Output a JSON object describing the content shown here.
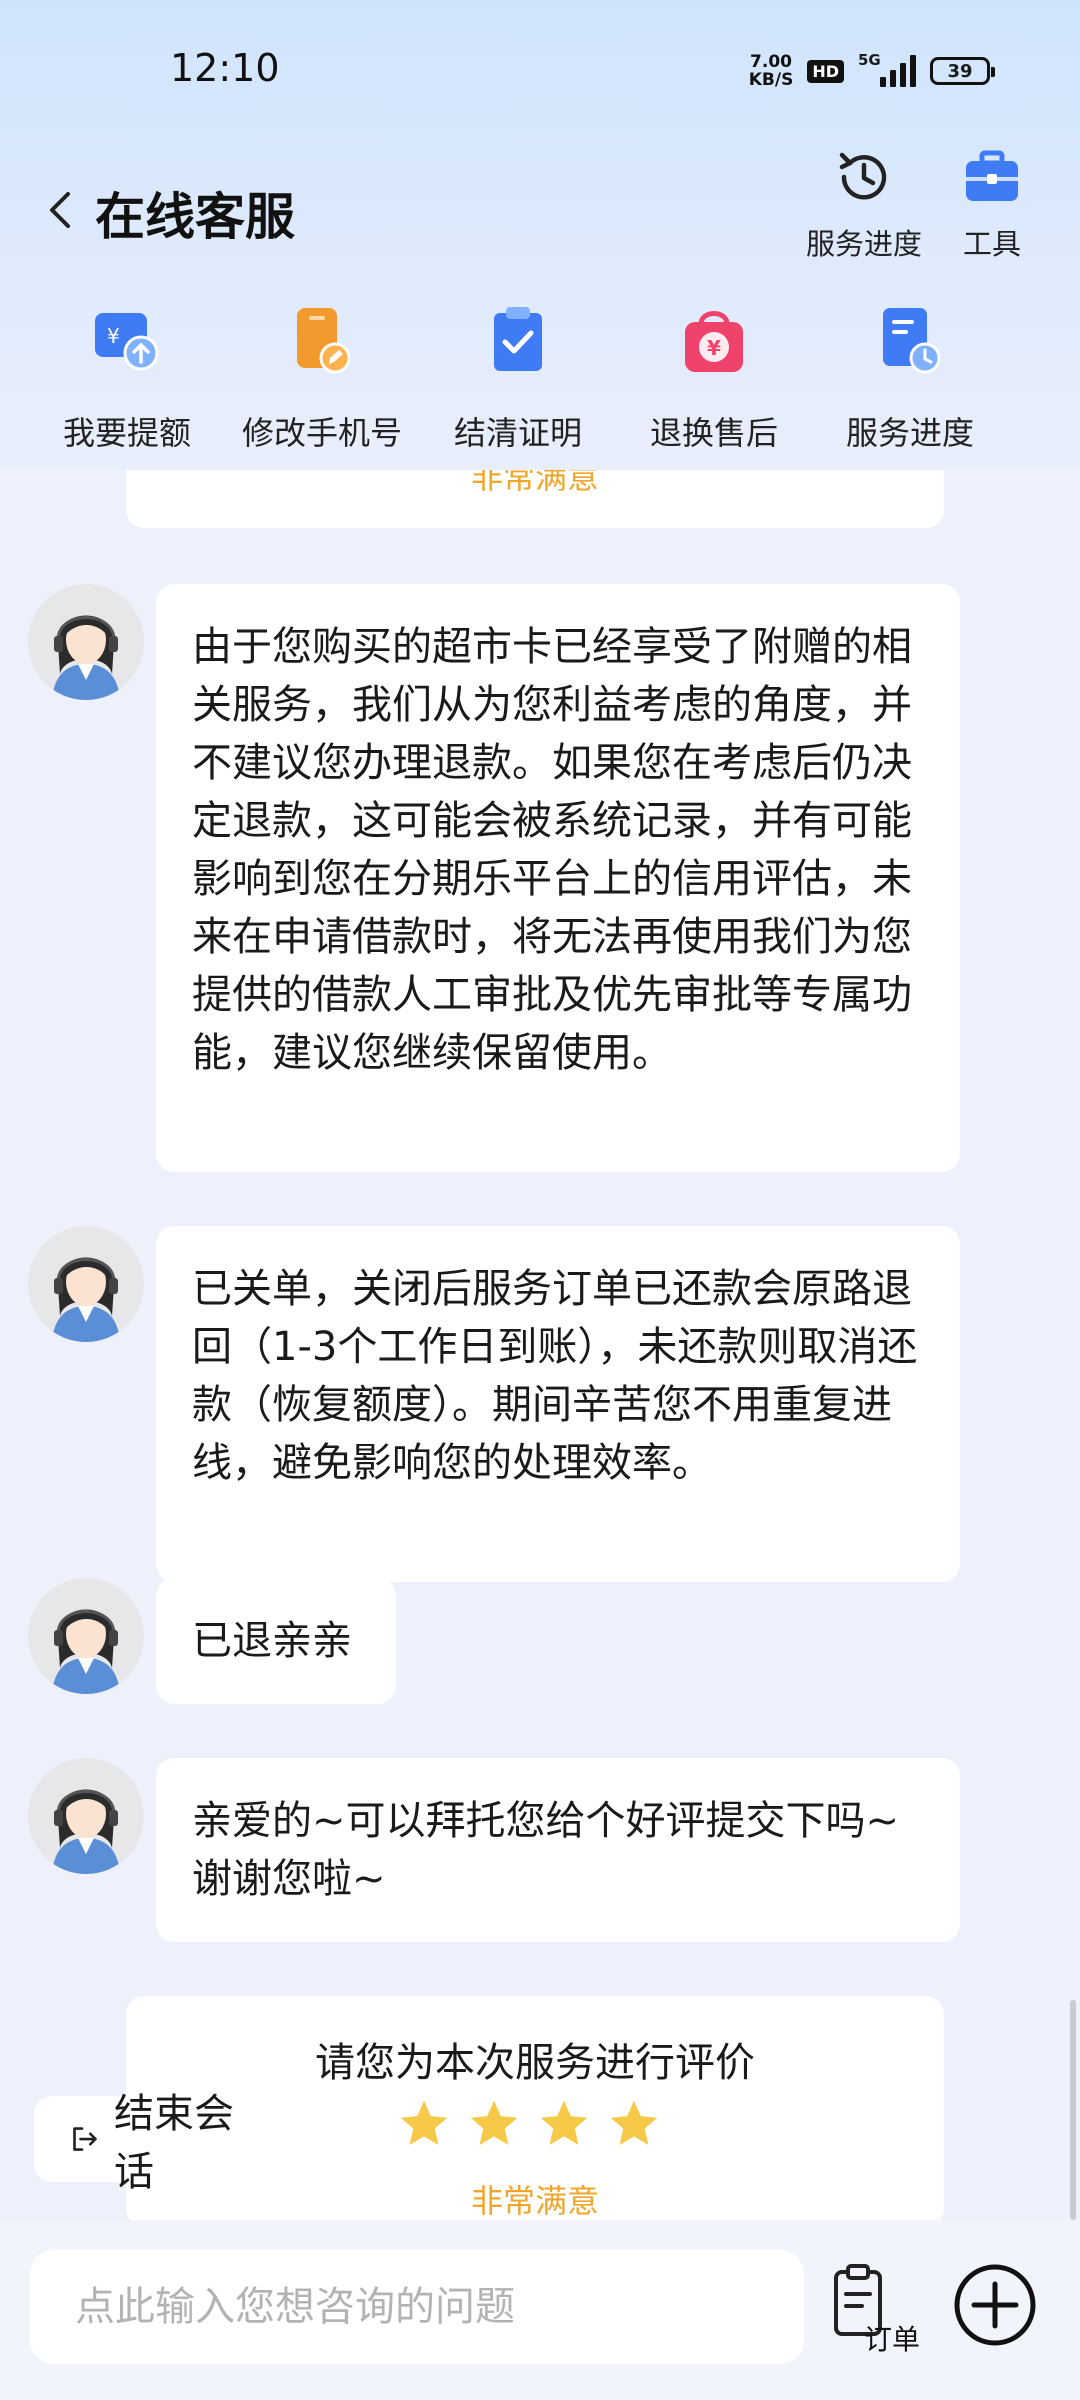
{
  "status_bar": {
    "time": "12:10",
    "net_speed_value": "7.00",
    "net_speed_unit": "KB/S",
    "hd_label": "HD",
    "network_label": "5G",
    "battery": "39"
  },
  "header": {
    "title": "在线客服",
    "actions": [
      {
        "label": "服务进度",
        "icon": "clock-history-icon"
      },
      {
        "label": "工具",
        "icon": "toolbox-icon"
      }
    ]
  },
  "shortcuts": [
    {
      "label": "我要提额",
      "icon": "wallet-upload-icon",
      "color": "#3f7bf5"
    },
    {
      "label": "修改手机号",
      "icon": "phone-edit-icon",
      "color": "#f39a2e"
    },
    {
      "label": "结清证明",
      "icon": "clipboard-check-icon",
      "color": "#3f7bf5"
    },
    {
      "label": "退换售后",
      "icon": "shopping-bag-yuan-icon",
      "color": "#f0436b"
    },
    {
      "label": "服务进度",
      "icon": "document-clock-icon",
      "color": "#3f7bf5"
    }
  ],
  "chat": {
    "top_rating_text": "非常满意",
    "messages": [
      {
        "text": "由于您购买的超市卡已经享受了附赠的相关服务，我们从为您利益考虑的角度，并不建议您办理退款。如果您在考虑后仍决定退款，这可能会被系统记录，并有可能影响到您在分期乐平台上的信用评估，未来在申请借款时，将无法再使用我们为您提供的借款人工审批及优先审批等专属功能，建议您继续保留使用。"
      },
      {
        "text": "已关单，关闭后服务订单已还款会原路退回（1-3个工作日到账），未还款则取消还款（恢复额度）。期间辛苦您不用重复进线，避免影响您的处理效率。"
      },
      {
        "text": "已退亲亲"
      },
      {
        "text": "亲爱的~可以拜托您给个好评提交下吗~谢谢您啦~"
      }
    ],
    "rating_card": {
      "prompt": "请您为本次服务进行评价",
      "stars": 4,
      "star_color": "#f7c948",
      "result": "非常满意"
    }
  },
  "end_chat_label": "结束会话",
  "input": {
    "placeholder": "点此输入您想咨询的问题",
    "value": ""
  },
  "order_label": "订单",
  "accent_color": "#f0a52b"
}
